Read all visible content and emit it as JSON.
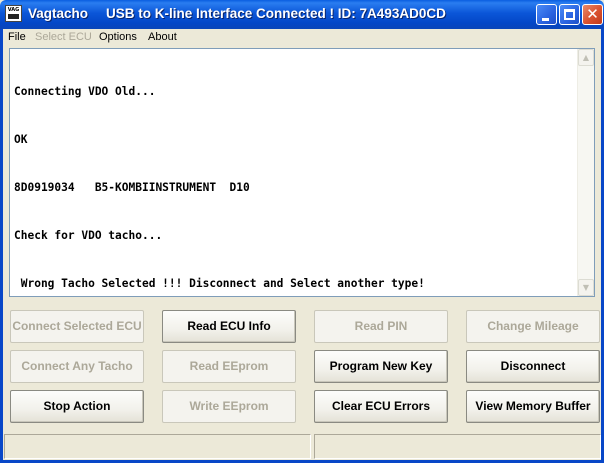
{
  "window": {
    "app_name": "Vagtacho",
    "status_title": "USB to K-line Interface Connected ! ID: 7A493AD0CD",
    "icon": "vagtacho-app-icon",
    "icon_text": "VAG"
  },
  "menu": {
    "items": [
      {
        "label": "File",
        "enabled": true
      },
      {
        "label": "Select ECU",
        "enabled": false
      },
      {
        "label": "Options",
        "enabled": true
      },
      {
        "label": "About",
        "enabled": true
      }
    ]
  },
  "output": {
    "lines": [
      "Connecting VDO Old...",
      "OK",
      "8D0919034   B5-KOMBIINSTRUMENT  D10",
      "Check for VDO tacho...",
      " Wrong Tacho Selected !!! Disconnect and Select another type!"
    ]
  },
  "buttons": {
    "connect_selected_ecu": {
      "label": "Connect Selected ECU",
      "enabled": false
    },
    "read_ecu_info": {
      "label": "Read  ECU Info",
      "enabled": true
    },
    "read_pin": {
      "label": "Read PIN",
      "enabled": false
    },
    "change_mileage": {
      "label": "Change Mileage",
      "enabled": false
    },
    "connect_any_tacho": {
      "label": "Connect Any Tacho",
      "enabled": false
    },
    "read_eeprom": {
      "label": "Read EEprom",
      "enabled": false
    },
    "program_new_key": {
      "label": "Program New Key",
      "enabled": true
    },
    "disconnect": {
      "label": "Disconnect",
      "enabled": true
    },
    "stop_action": {
      "label": "Stop Action",
      "enabled": true
    },
    "write_eeprom": {
      "label": "Write EEprom",
      "enabled": false
    },
    "clear_ecu_errors": {
      "label": "Clear ECU Errors",
      "enabled": true
    },
    "view_memory_buffer": {
      "label": "View Memory Buffer",
      "enabled": true
    }
  },
  "statusbar": {
    "panel1": "",
    "panel2": ""
  },
  "colors": {
    "titlebar": "#0b56d8",
    "window_bg": "#ece9d8",
    "disabled_text": "#aca899",
    "close_button": "#d9512f"
  }
}
